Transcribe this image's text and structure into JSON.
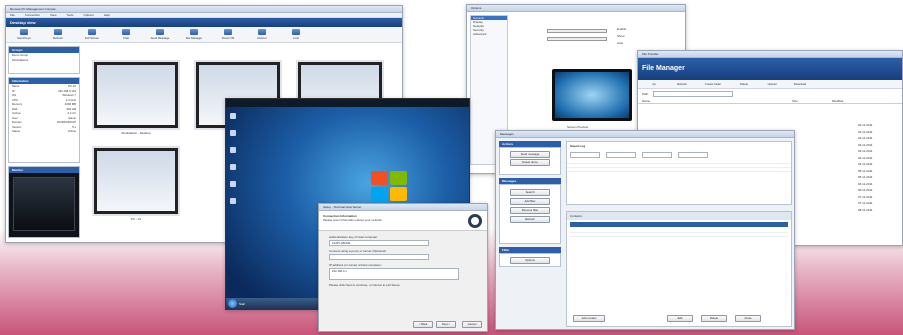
{
  "main_window": {
    "title": "Remote PC Management Console",
    "menu": [
      "File",
      "Connection",
      "View",
      "Tools",
      "Options",
      "Help"
    ],
    "banner": "Desktop view",
    "toolbar": [
      "Send Keys",
      "Refresh",
      "Full Screen",
      "Chat",
      "Send Message",
      "File Manager",
      "Power Off",
      "Reboot",
      "Lock"
    ],
    "sidebar": {
      "groups_header": "Groups",
      "groups": [
        "Demo Group",
        "Workstations"
      ],
      "info_header": "Information",
      "props": [
        {
          "k": "Name",
          "v": "PC-01"
        },
        {
          "k": "IP",
          "v": "192.168.0.101"
        },
        {
          "k": "OS",
          "v": "Windows 7"
        },
        {
          "k": "CPU",
          "v": "2.4 GHz"
        },
        {
          "k": "Memory",
          "v": "4096 MB"
        },
        {
          "k": "Disk",
          "v": "500 GB"
        },
        {
          "k": "Uptime",
          "v": "2 d 4 h"
        },
        {
          "k": "User",
          "v": "Admin"
        },
        {
          "k": "Domain",
          "v": "WORKGROUP"
        },
        {
          "k": "Version",
          "v": "5.1"
        },
        {
          "k": "Status",
          "v": "Online"
        }
      ],
      "monitor_header": "Monitor"
    },
    "thumbs": [
      {
        "caption": "Workstation - Desktop"
      },
      {
        "caption": "Laptop - Demo"
      },
      {
        "caption": "Server"
      },
      {
        "caption": "PC - 01"
      }
    ]
  },
  "desktop": {
    "start_label": "Start"
  },
  "setup_dialog": {
    "title": "Setup - Terminal Host Server",
    "header": "Connection Information",
    "subheader": "Please enter information about your network",
    "fields": [
      {
        "label": "Authentication key of Host computer:",
        "value": "12345-ABCDE"
      },
      {
        "label": "Connect using a proxy or server (Optional):",
        "value": ""
      },
      {
        "label": "IP address (or name) of Host computer:",
        "value": "192.168.0.1"
      }
    ],
    "note": "Please click Next to continue, or Cancel to exit Setup.",
    "buttons": [
      "< Back",
      "Next >",
      "Cancel"
    ]
  },
  "top_window": {
    "title": "Options",
    "sidebar": [
      "General",
      "Display",
      "Network",
      "Security",
      "Advanced"
    ],
    "checks": [
      "Enable",
      "Show",
      "Auto"
    ],
    "caption": "Screen Preview"
  },
  "file_manager": {
    "title": "File Transfer",
    "banner": "File Manager",
    "toolbar": [
      "Up",
      "Refresh",
      "Create folder",
      "Delete",
      "Upload",
      "Download"
    ],
    "path_label": "Path:",
    "columns": [
      "Name",
      "Size",
      "Modified"
    ],
    "dates": [
      "02.11.2011",
      "02.11.2011",
      "02.11.2011",
      "03.11.2011",
      "03.11.2011",
      "04.11.2011",
      "04.11.2011",
      "05.11.2011",
      "05.11.2011",
      "06.11.2011",
      "06.11.2011",
      "07.11.2011",
      "07.11.2011",
      "08.11.2011"
    ]
  },
  "messages_window": {
    "title": "Messages",
    "left_sections": [
      "Actions",
      "Messages",
      "Filter"
    ],
    "left_buttons": [
      "Send message",
      "Delete items",
      "Search",
      "Add filter",
      "Remove filter",
      "Refresh",
      "Options"
    ],
    "top_header": "Saved Log",
    "bottom_header": "Contacts",
    "bottom_buttons": [
      "Add contact",
      "Edit",
      "Delete",
      "Close"
    ]
  }
}
